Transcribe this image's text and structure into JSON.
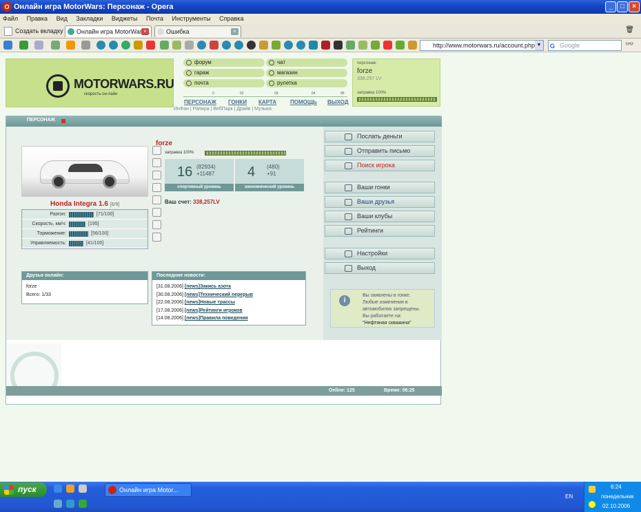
{
  "window": {
    "title": "Онлайн игра MotorWars: Персонаж - Opera",
    "logo_glyph": "O"
  },
  "menu": [
    "Файл",
    "Правка",
    "Вид",
    "Закладки",
    "Виджеты",
    "Почта",
    "Инструменты",
    "Справка"
  ],
  "tabs": {
    "new_tab": "Создать вкладку",
    "items": [
      "Онлайн игра MotorWars...",
      "Ошибка"
    ]
  },
  "address": {
    "url": "http://www.motorwars.ru/account.php",
    "search_placeholder": "Google",
    "search_glyph": "G"
  },
  "site": {
    "brand": "MOTORWARS.RU",
    "slogan": "скорость он-лайн",
    "quick_links": [
      "форум",
      "чат",
      "гараж",
      "магазин",
      "почта",
      "рулетка"
    ],
    "scale": [
      "0",
      "02",
      "03",
      "04",
      "05"
    ],
    "nav": [
      "ПЕРСОНАЖ",
      "ГОНКИ",
      "КАРТА",
      "ПОМОЩЬ",
      "ВЫХОД"
    ],
    "subnav": "ИнФан | Рапира | ВебПарк | Драйв | Музыка",
    "persona_box": {
      "label": "персонаж:",
      "name": "forze",
      "lv": "338,257 LV",
      "fuel": "заправка 100%"
    }
  },
  "panel": {
    "title": "ПЕРСОНАЖ",
    "player": "forze",
    "fuel": "заправка 100%",
    "car": {
      "name": "Honda Integra 1.6",
      "slots": "[6/9]"
    },
    "stats": [
      {
        "label": "Разгон:",
        "value": "[71/100]",
        "level": 71
      },
      {
        "label": "Скорость, км/ч:",
        "value": "[195]",
        "level": 48
      },
      {
        "label": "Торможение:",
        "value": "[56/100]",
        "level": 56
      },
      {
        "label": "Управляемость:",
        "value": "[41/100]",
        "level": 41
      }
    ],
    "sport": {
      "level": "16",
      "a": "(82934)",
      "b": "+11487",
      "caption": "спортивный уровень"
    },
    "econ": {
      "level": "4",
      "a": "(480)",
      "b": "+91",
      "caption": "экономический уровень"
    },
    "balance_label": "Ваш счет:",
    "balance": "338,257LV",
    "friends": {
      "title": "Друзья онлайн:",
      "items": [
        "forze"
      ],
      "total": "Всего: 1/33"
    },
    "news": {
      "title": "Последние новости:",
      "items": [
        {
          "date": "[31.08.2006]",
          "tag": "[news]",
          "text": "Закись азота"
        },
        {
          "date": "[30.08.2006]",
          "tag": "[news]",
          "text": "Технический перерыв"
        },
        {
          "date": "[22.08.2006]",
          "tag": "[news]",
          "text": "Новые трассы"
        },
        {
          "date": "[17.08.2006]",
          "tag": "[news]",
          "text": "Рейтинги игроков"
        },
        {
          "date": "[14.08.2006]",
          "tag": "[news]",
          "text": "Правила поведения"
        }
      ]
    },
    "side_menu": [
      "Послать деньги",
      "Отправить письмо",
      "Поиск игрока",
      "Ваши гонки",
      "Ваши друзья",
      "Ваши клубы",
      "Рейтинги",
      "Настройки",
      "Выход"
    ],
    "info": [
      "Вы заявлены в гонке.",
      "Любые изменения в",
      "автомобилях запрещены.",
      "Вы работаете на:",
      "\"Нефтяная скважина\""
    ],
    "info_glyph": "i",
    "online": "Online: 125",
    "time": "Время: 06:25"
  },
  "taskbar": {
    "start": "пуск",
    "item": "Онлайн игра Motor...",
    "lang": "EN",
    "time": "6:24",
    "day": "понедельник",
    "date": "02.10.2006"
  }
}
